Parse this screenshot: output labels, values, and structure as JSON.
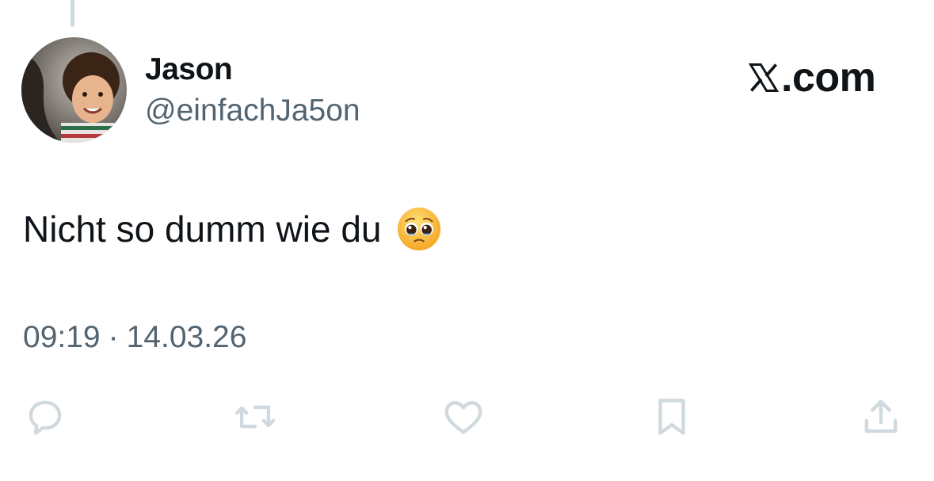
{
  "tweet": {
    "author": {
      "display_name": "Jason",
      "handle": "@einfachJa5on",
      "avatar_icon": "profile-photo"
    },
    "brand": {
      "logo_icon": "x-logo-icon",
      "text": ".com"
    },
    "text": "Nicht so dumm wie du",
    "emoji": "pleading-face",
    "time": "09:19",
    "separator": "·",
    "date": "14.03.26"
  },
  "actions": [
    {
      "icon": "reply-icon"
    },
    {
      "icon": "retweet-icon"
    },
    {
      "icon": "like-icon"
    },
    {
      "icon": "bookmark-icon"
    },
    {
      "icon": "share-icon"
    }
  ],
  "colors": {
    "text_primary": "#0f1419",
    "text_secondary": "#536471",
    "icon_muted": "#cfd9de",
    "thread_line": "#cfd9de"
  }
}
